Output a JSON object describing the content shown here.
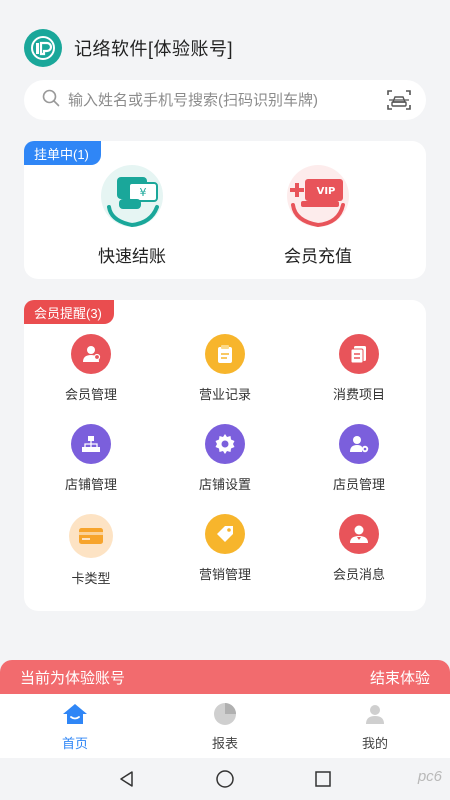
{
  "header": {
    "title": "记络软件[体验账号]",
    "logo_icon": "ip-logo"
  },
  "search": {
    "placeholder": "输入姓名或手机号搜索(扫码识别车牌)",
    "scan_icon": "scan-plate-icon"
  },
  "quick": {
    "badge": "挂单中(1)",
    "items": [
      {
        "label": "快速结账",
        "icon": "cashier-hand-icon"
      },
      {
        "label": "会员充值",
        "icon": "vip-card-icon"
      }
    ]
  },
  "members": {
    "badge": "会员提醒(3)",
    "items": [
      {
        "label": "会员管理",
        "icon": "member-group-icon",
        "color": "#e8545a"
      },
      {
        "label": "营业记录",
        "icon": "clipboard-icon",
        "color": "#f7b52c"
      },
      {
        "label": "消费项目",
        "icon": "document-list-icon",
        "color": "#e8545a"
      },
      {
        "label": "店铺管理",
        "icon": "org-chart-icon",
        "color": "#7b5fdc"
      },
      {
        "label": "店铺设置",
        "icon": "gear-icon",
        "color": "#7b5fdc"
      },
      {
        "label": "店员管理",
        "icon": "user-settings-icon",
        "color": "#7b5fdc"
      },
      {
        "label": "卡类型",
        "icon": "card-icon",
        "color": "#f7a42c"
      },
      {
        "label": "营销管理",
        "icon": "price-tag-icon",
        "color": "#f7a42c"
      },
      {
        "label": "会员消息",
        "icon": "user-message-icon",
        "color": "#e8545a"
      }
    ]
  },
  "trial": {
    "status": "当前为体验账号",
    "action": "结束体验"
  },
  "tabs": [
    {
      "label": "首页",
      "icon": "home-icon",
      "active": true
    },
    {
      "label": "报表",
      "icon": "pie-chart-icon",
      "active": false
    },
    {
      "label": "我的",
      "icon": "profile-icon",
      "active": false
    }
  ],
  "colors": {
    "accent": "#2f86f6",
    "danger": "#ea4d4f",
    "brand": "#1aa79a",
    "trial_bar": "#f26b6e"
  },
  "watermark": "pc6"
}
